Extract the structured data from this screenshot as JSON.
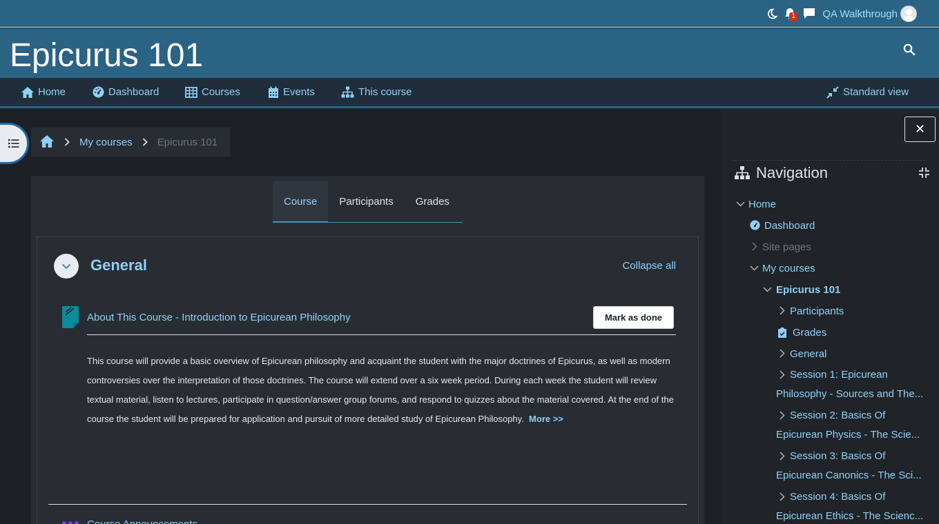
{
  "topbar": {
    "username": "QA Walkthrough",
    "notification_count": "1",
    "icons": [
      "moon-icon",
      "bell-icon",
      "chat-icon"
    ]
  },
  "header": {
    "site_title": "Epicurus 101"
  },
  "navbar": {
    "items": [
      {
        "label": "Home",
        "icon": "home-icon"
      },
      {
        "label": "Dashboard",
        "icon": "dashboard-icon"
      },
      {
        "label": "Courses",
        "icon": "table-icon"
      },
      {
        "label": "Events",
        "icon": "calendar-icon"
      },
      {
        "label": "This course",
        "icon": "sitemap-icon"
      }
    ],
    "standard_view": "Standard view"
  },
  "breadcrumb": {
    "link": "My courses",
    "current": "Epicurus 101"
  },
  "tabs": [
    {
      "label": "Course",
      "active": true
    },
    {
      "label": "Participants",
      "active": false
    },
    {
      "label": "Grades",
      "active": false
    }
  ],
  "section": {
    "title": "General",
    "collapse_all": "Collapse all"
  },
  "activity": {
    "name": "About This Course - Introduction to Epicurean Philosophy",
    "mark_done": "Mark as done",
    "description": "This course will provide a basic overview of Epicurean philosophy and acquaint the student with the major doctrines of Epicurus, as well as modern controversies over the interpretation of those doctrines.  The course will extend over a six week period. During each week the student will review textual material, listen to lectures, participate in question/answer group forums, and respond to quizzes about the material covered.  At the end of the course the student will be prepared for application and pursuit of more detailed study of Epicurean Philosophy.",
    "more": "More >>"
  },
  "next_activity": {
    "name": "Course Announcements"
  },
  "drawer": {
    "close": "✕",
    "title": "Navigation",
    "tree": {
      "home": "Home",
      "dashboard": "Dashboard",
      "site_pages": "Site pages",
      "my_courses": "My courses",
      "course": "Epicurus 101",
      "participants": "Participants",
      "grades": "Grades",
      "general": "General",
      "session1": "Session 1: Epicurean Philosophy - Sources and The...",
      "session2": "Session 2: Basics Of Epicurean Physics - The Scie...",
      "session3": "Session 3: Basics Of Epicurean Canonics - The Sci...",
      "session4": "Session 4: Basics Of Epicurean Ethics - The Scienc..."
    }
  },
  "colors": {
    "brand": "#2a6384",
    "link": "#8fd0f8",
    "background": "#1d2125",
    "panel": "#282d33",
    "badge": "#ca3120"
  }
}
